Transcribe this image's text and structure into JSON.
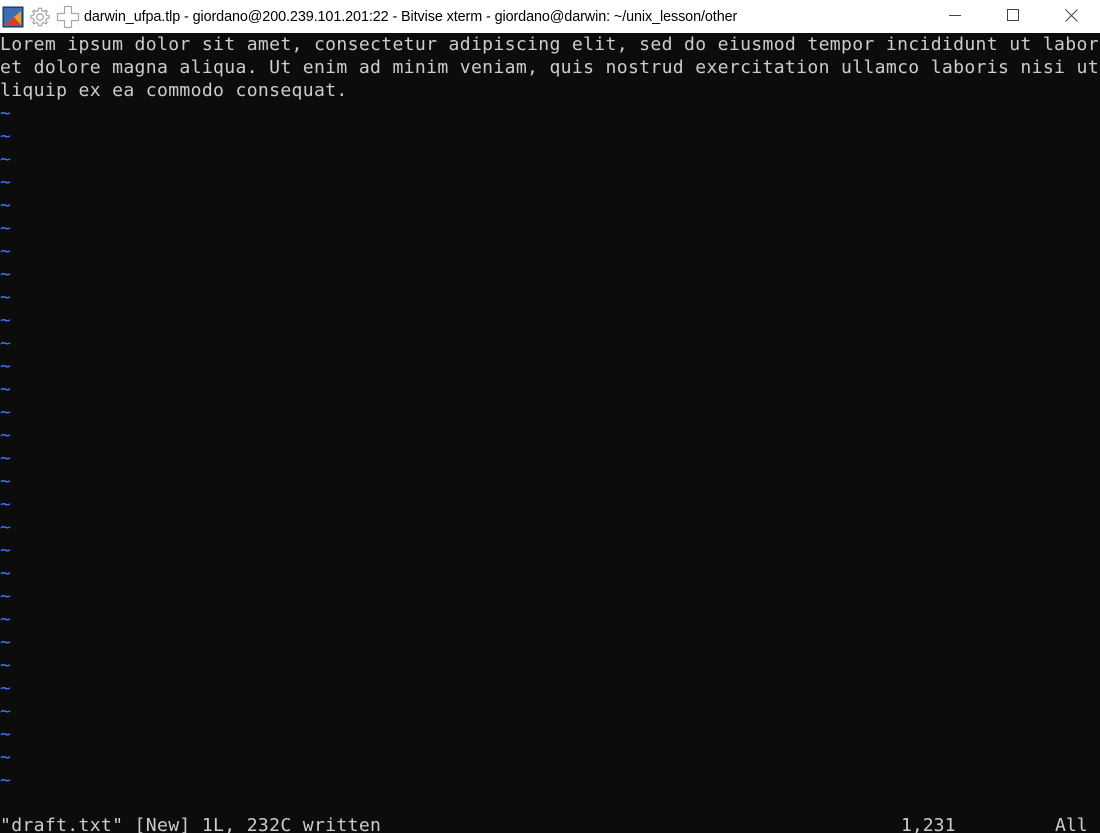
{
  "window": {
    "title": "darwin_ufpa.tlp - giordano@200.239.101.201:22 - Bitvise xterm - giordano@darwin: ~/unix_lesson/other",
    "icons": {
      "app": "bitvise-app-icon",
      "gear": "gear-icon",
      "new_window": "plus-icon",
      "minimize": "minimize-icon",
      "maximize": "maximize-icon",
      "close": "close-icon"
    }
  },
  "editor": {
    "buffer_lines": [
      "Lorem ipsum dolor sit amet, consectetur adipiscing elit, sed do eiusmod tempor incididunt ut labore",
      "et dolore magna aliqua. Ut enim ad minim veniam, quis nostrud exercitation ullamco laboris nisi ut a",
      "liquip ex ea commodo consequat."
    ],
    "empty_line_marker": "~",
    "empty_line_count": 30,
    "colors": {
      "background": "#0c0c0c",
      "text": "#cccccc",
      "tilde": "#3b78ff"
    },
    "status": {
      "message": "\"draft.txt\" [New] 1L, 232C written",
      "position": "1,231",
      "scroll": "All"
    }
  }
}
